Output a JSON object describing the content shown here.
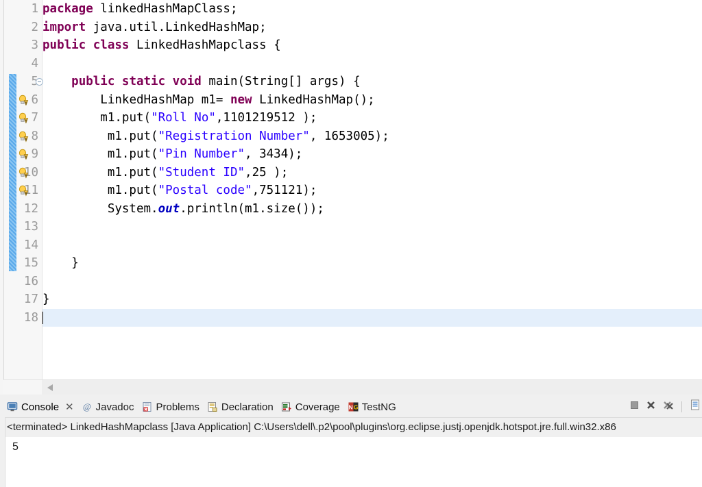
{
  "editor": {
    "language": "java",
    "cursor_line": 18,
    "lines": [
      {
        "no": 1,
        "indent": 0,
        "marker": null,
        "fold": false,
        "tokens": [
          {
            "t": "package",
            "c": "kw"
          },
          {
            "t": " linkedHashMapClass;",
            "c": "plain"
          }
        ]
      },
      {
        "no": 2,
        "indent": 0,
        "marker": null,
        "fold": false,
        "tokens": [
          {
            "t": "import",
            "c": "kw"
          },
          {
            "t": " java.util.LinkedHashMap;",
            "c": "plain"
          }
        ]
      },
      {
        "no": 3,
        "indent": 0,
        "marker": null,
        "fold": false,
        "tokens": [
          {
            "t": "public class",
            "c": "kw"
          },
          {
            "t": " LinkedHashMapclass {",
            "c": "plain"
          }
        ]
      },
      {
        "no": 4,
        "indent": 0,
        "marker": null,
        "fold": false,
        "tokens": []
      },
      {
        "no": 5,
        "indent": 0,
        "marker": null,
        "fold": true,
        "tokens": [
          {
            "t": "    ",
            "c": "plain"
          },
          {
            "t": "public static void",
            "c": "kw"
          },
          {
            "t": " main(String[] args) {",
            "c": "plain"
          }
        ]
      },
      {
        "no": 6,
        "indent": 0,
        "marker": "warning",
        "fold": false,
        "tokens": [
          {
            "t": "        ",
            "c": "plain"
          },
          {
            "t": "LinkedHashMap",
            "c": "plain",
            "sq": true
          },
          {
            "t": " m1= ",
            "c": "plain"
          },
          {
            "t": "new",
            "c": "kw"
          },
          {
            "t": " ",
            "c": "plain"
          },
          {
            "t": "LinkedHashMap",
            "c": "plain",
            "sq": true
          },
          {
            "t": "();",
            "c": "plain"
          }
        ]
      },
      {
        "no": 7,
        "indent": 0,
        "marker": "warning",
        "fold": false,
        "tokens": [
          {
            "t": "        ",
            "c": "plain"
          },
          {
            "t": "m1.put",
            "c": "plain",
            "sq": true
          },
          {
            "t": "(",
            "c": "plain"
          },
          {
            "t": "\"Roll No\"",
            "c": "str"
          },
          {
            "t": ",1101219512 );",
            "c": "plain"
          }
        ]
      },
      {
        "no": 8,
        "indent": 0,
        "marker": "warning",
        "fold": false,
        "tokens": [
          {
            "t": "         ",
            "c": "plain"
          },
          {
            "t": "m1.put",
            "c": "plain",
            "sq": true
          },
          {
            "t": "(",
            "c": "plain"
          },
          {
            "t": "\"Registration Number\"",
            "c": "str"
          },
          {
            "t": ", 1653005);",
            "c": "plain"
          }
        ]
      },
      {
        "no": 9,
        "indent": 0,
        "marker": "warning",
        "fold": false,
        "tokens": [
          {
            "t": "         ",
            "c": "plain"
          },
          {
            "t": "m1.put",
            "c": "plain",
            "sq": true
          },
          {
            "t": "(",
            "c": "plain"
          },
          {
            "t": "\"Pin Number\"",
            "c": "str"
          },
          {
            "t": ", 3434);",
            "c": "plain"
          }
        ]
      },
      {
        "no": 10,
        "indent": 0,
        "marker": "warning",
        "fold": false,
        "tokens": [
          {
            "t": "         ",
            "c": "plain"
          },
          {
            "t": "m1.put",
            "c": "plain",
            "sq": true
          },
          {
            "t": "(",
            "c": "plain"
          },
          {
            "t": "\"Student ID\"",
            "c": "str"
          },
          {
            "t": ",25 );",
            "c": "plain"
          }
        ]
      },
      {
        "no": 11,
        "indent": 0,
        "marker": "warning",
        "fold": false,
        "tokens": [
          {
            "t": "         ",
            "c": "plain"
          },
          {
            "t": "m1.put",
            "c": "plain",
            "sq": true
          },
          {
            "t": "(",
            "c": "plain"
          },
          {
            "t": "\"Postal code\"",
            "c": "str"
          },
          {
            "t": ",751121);",
            "c": "plain"
          }
        ]
      },
      {
        "no": 12,
        "indent": 0,
        "marker": null,
        "fold": false,
        "tokens": [
          {
            "t": "         System.",
            "c": "plain"
          },
          {
            "t": "out",
            "c": "fld"
          },
          {
            "t": ".println(m1.size());",
            "c": "plain"
          }
        ]
      },
      {
        "no": 13,
        "indent": 0,
        "marker": null,
        "fold": false,
        "tokens": []
      },
      {
        "no": 14,
        "indent": 0,
        "marker": null,
        "fold": false,
        "tokens": []
      },
      {
        "no": 15,
        "indent": 0,
        "marker": null,
        "fold": false,
        "tokens": [
          {
            "t": "    }",
            "c": "plain"
          }
        ]
      },
      {
        "no": 16,
        "indent": 0,
        "marker": null,
        "fold": false,
        "tokens": []
      },
      {
        "no": 17,
        "indent": 0,
        "marker": null,
        "fold": false,
        "tokens": [
          {
            "t": "}",
            "c": "plain"
          }
        ]
      },
      {
        "no": 18,
        "indent": 0,
        "marker": null,
        "fold": false,
        "current": true,
        "tokens": []
      }
    ]
  },
  "panel": {
    "tabs": [
      {
        "label": "Console",
        "icon": "console-icon",
        "active": true,
        "closable": true
      },
      {
        "label": "Javadoc",
        "icon": "javadoc-icon",
        "active": false,
        "closable": false
      },
      {
        "label": "Problems",
        "icon": "problems-icon",
        "active": false,
        "closable": false
      },
      {
        "label": "Declaration",
        "icon": "declaration-icon",
        "active": false,
        "closable": false
      },
      {
        "label": "Coverage",
        "icon": "coverage-icon",
        "active": false,
        "closable": false
      },
      {
        "label": "TestNG",
        "icon": "testng-icon",
        "active": false,
        "closable": false
      }
    ],
    "toolbar_icons": [
      "terminate-icon",
      "remove-launch-icon",
      "remove-all-terminated-icon",
      "open-console-icon"
    ],
    "terminated_line": "<terminated> LinkedHashMapclass [Java Application] C:\\Users\\dell\\.p2\\pool\\plugins\\org.eclipse.justj.openjdk.hotspot.jre.full.win32.x86",
    "console_output": "5"
  },
  "colors": {
    "keyword": "#7f0055",
    "string": "#2a00ff",
    "static_field": "#0000c0",
    "line_number": "#9a9a9a",
    "current_line_highlight": "#e4effb",
    "quick_diff_change": "#5aa9ea",
    "warning_squiggle": "#e8c33a",
    "panel_bg": "#f0f0f0"
  }
}
